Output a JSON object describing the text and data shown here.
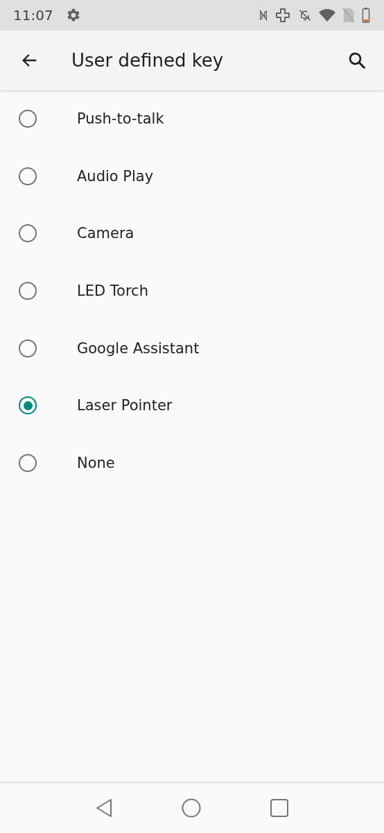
{
  "status_bar": {
    "time": "11:07"
  },
  "app_bar": {
    "title": "User defined key"
  },
  "options": [
    {
      "label": "Push-to-talk",
      "selected": false
    },
    {
      "label": "Audio Play",
      "selected": false
    },
    {
      "label": "Camera",
      "selected": false
    },
    {
      "label": "LED Torch",
      "selected": false
    },
    {
      "label": "Google Assistant",
      "selected": false
    },
    {
      "label": "Laser Pointer",
      "selected": true
    },
    {
      "label": "None",
      "selected": false
    }
  ]
}
